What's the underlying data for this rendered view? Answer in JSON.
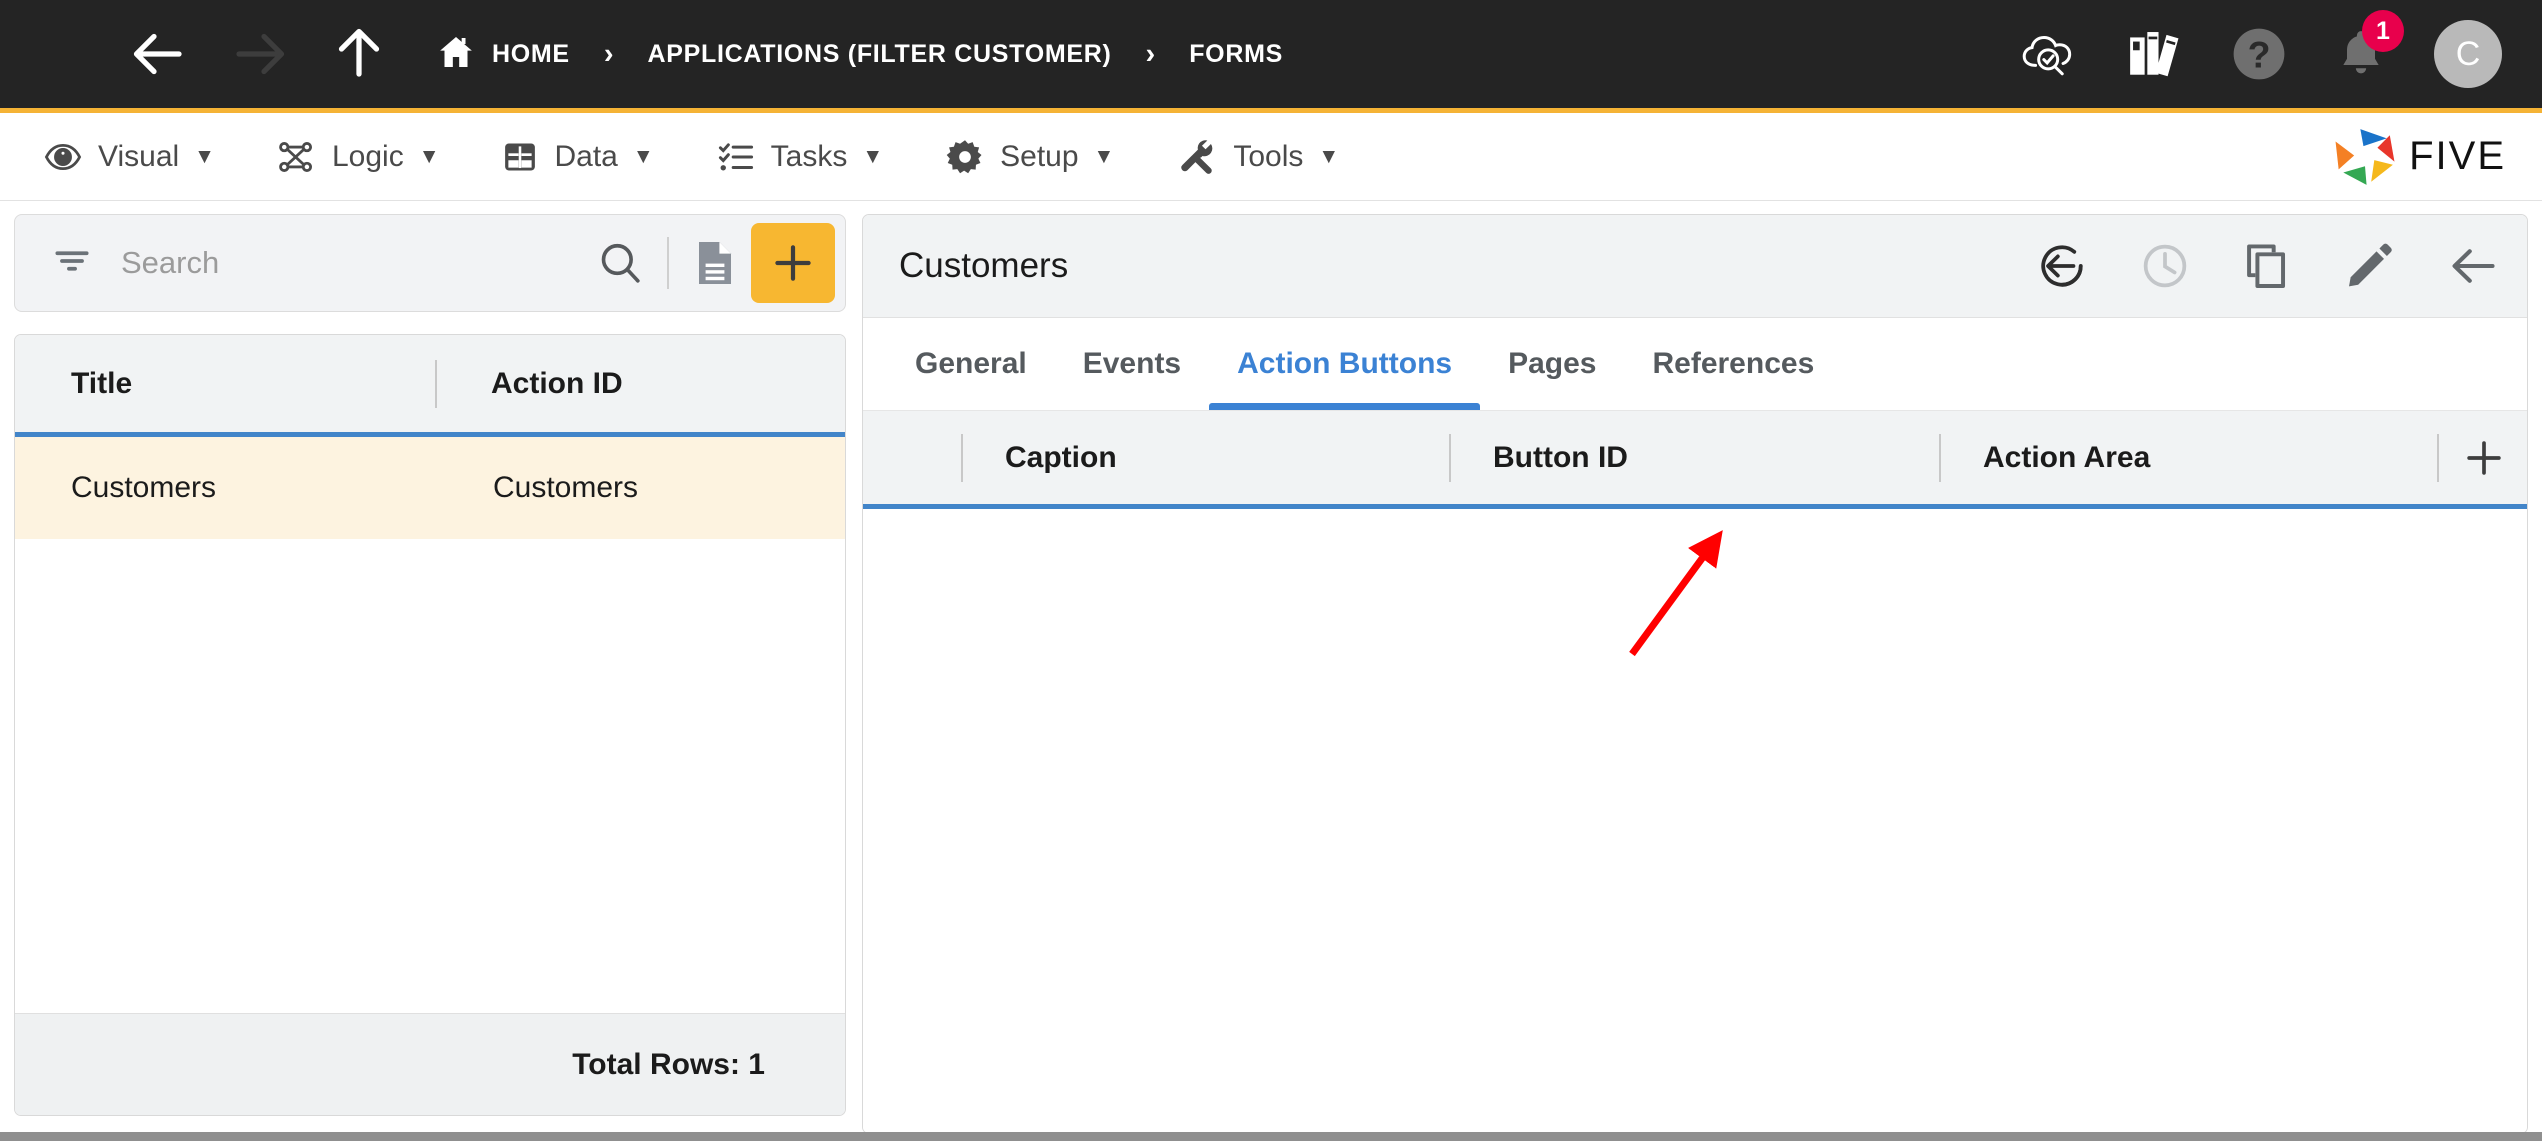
{
  "topbar": {
    "icons": {
      "menu": "hamburger-icon",
      "back": "back-arrow-icon",
      "forward": "forward-arrow-icon",
      "up": "up-arrow-icon",
      "home": "home-icon"
    },
    "breadcrumb": [
      {
        "label": "HOME",
        "icon": "home-icon"
      },
      {
        "label": "APPLICATIONS (FILTER CUSTOMER)"
      },
      {
        "label": "FORMS"
      }
    ],
    "separator": "›",
    "right_icons": [
      {
        "name": "cloud-check-search-icon"
      },
      {
        "name": "library-books-icon"
      },
      {
        "name": "help-icon"
      },
      {
        "name": "notifications-bell-icon",
        "badge": "1"
      }
    ],
    "avatar_initial": "C",
    "badge_color": "#E8004C",
    "accent_color": "#F5B335"
  },
  "menubar": {
    "items": [
      {
        "label": "Visual",
        "icon": "eye-icon",
        "caret": "▼"
      },
      {
        "label": "Logic",
        "icon": "logic-flow-icon",
        "caret": "▼"
      },
      {
        "label": "Data",
        "icon": "table-grid-icon",
        "caret": "▼"
      },
      {
        "label": "Tasks",
        "icon": "checklist-icon",
        "caret": "▼"
      },
      {
        "label": "Setup",
        "icon": "gear-icon",
        "caret": "▼"
      },
      {
        "label": "Tools",
        "icon": "tools-icon",
        "caret": "▼"
      }
    ],
    "logo_text": "FIVE"
  },
  "left_panel": {
    "search": {
      "placeholder": "Search",
      "filter_icon": "filter-icon",
      "search_icon": "search-icon",
      "document_icon": "document-icon",
      "add_icon": "plus-icon",
      "add_button_color": "#F7B731"
    },
    "grid": {
      "columns": [
        "Title",
        "Action ID"
      ],
      "rows": [
        {
          "title": "Customers",
          "action_id": "Customers"
        }
      ],
      "selected_row_index": 0,
      "selected_row_color": "#FDF3E0",
      "footer": "Total Rows: 1"
    }
  },
  "right_panel": {
    "title": "Customers",
    "header_icons": [
      {
        "name": "undo-circle-icon"
      },
      {
        "name": "history-clock-icon"
      },
      {
        "name": "copy-icon"
      },
      {
        "name": "edit-pencil-icon"
      },
      {
        "name": "back-arrow-icon"
      }
    ],
    "tabs": [
      {
        "label": "General",
        "active": false
      },
      {
        "label": "Events",
        "active": false
      },
      {
        "label": "Action Buttons",
        "active": true
      },
      {
        "label": "Pages",
        "active": false
      },
      {
        "label": "References",
        "active": false
      }
    ],
    "active_tab_color": "#3B82D4",
    "grid": {
      "columns": [
        "Caption",
        "Button ID",
        "Action Area"
      ],
      "add_icon": "plus-icon",
      "rows": []
    },
    "annotation": {
      "type": "arrow",
      "color": "#FF0000",
      "points_to": "plus-icon"
    }
  }
}
